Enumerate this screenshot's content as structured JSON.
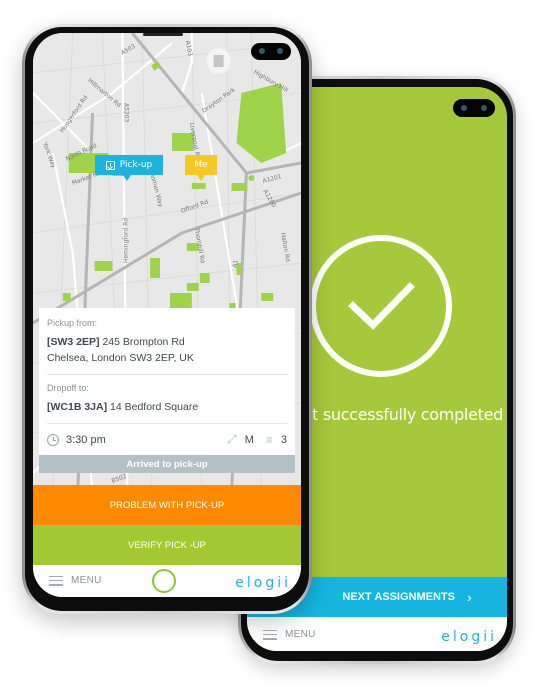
{
  "back_phone": {
    "status_icon": "check-circle-icon",
    "success_message": "Assignment successfully completed",
    "next_button_label": "NEXT ASSIGNMENTS",
    "next_button_icon": "chevron-right-icon",
    "nav": {
      "menu_label": "MENU",
      "logo": "elogii"
    }
  },
  "front_phone": {
    "map": {
      "markers": [
        {
          "label": "Pick-up",
          "icon": "download-icon",
          "color": "#1cb3e0"
        },
        {
          "label": "Me",
          "color": "#f7c824"
        }
      ],
      "street_labels": [
        "A503",
        "A103",
        "Hillmarton Rd",
        "Hungerford Rd",
        "North Road",
        "York Way",
        "Market Rd",
        "A5203",
        "Roman Way",
        "Liverpool Rd",
        "Drayton Park",
        "Highbury Hill",
        "A1201",
        "A1200",
        "Offord Rd",
        "Hemingford Rd",
        "Thornhill Rd",
        "Halton Rd",
        "A1",
        "B502"
      ]
    },
    "card": {
      "pickup_label": "Pickup from:",
      "pickup_code": "[SW3 2EP]",
      "pickup_line1": "245 Brompton Rd",
      "pickup_line2": "Chelsea, London SW3 2EP, UK",
      "dropoff_label": "Dropoff to:",
      "dropoff_code": "[WC1B 3JA]",
      "dropoff_line1": "14 Bedford Square",
      "time": "3:30 pm",
      "size": "M",
      "items_count": "3"
    },
    "status_bar": "Arrived to pick-up",
    "problem_button": "PROBLEM WITH PICK-UP",
    "verify_button": "VERIFY PICK -UP",
    "nav": {
      "menu_label": "MENU",
      "logo": "elogii"
    }
  },
  "colors": {
    "success_green": "#a5c93a",
    "accent_blue": "#16b5e0",
    "problem_orange": "#ff8a00",
    "verify_green": "#a3c932",
    "arrived_gray": "#b3c0c8",
    "me_yellow": "#f7c824"
  }
}
